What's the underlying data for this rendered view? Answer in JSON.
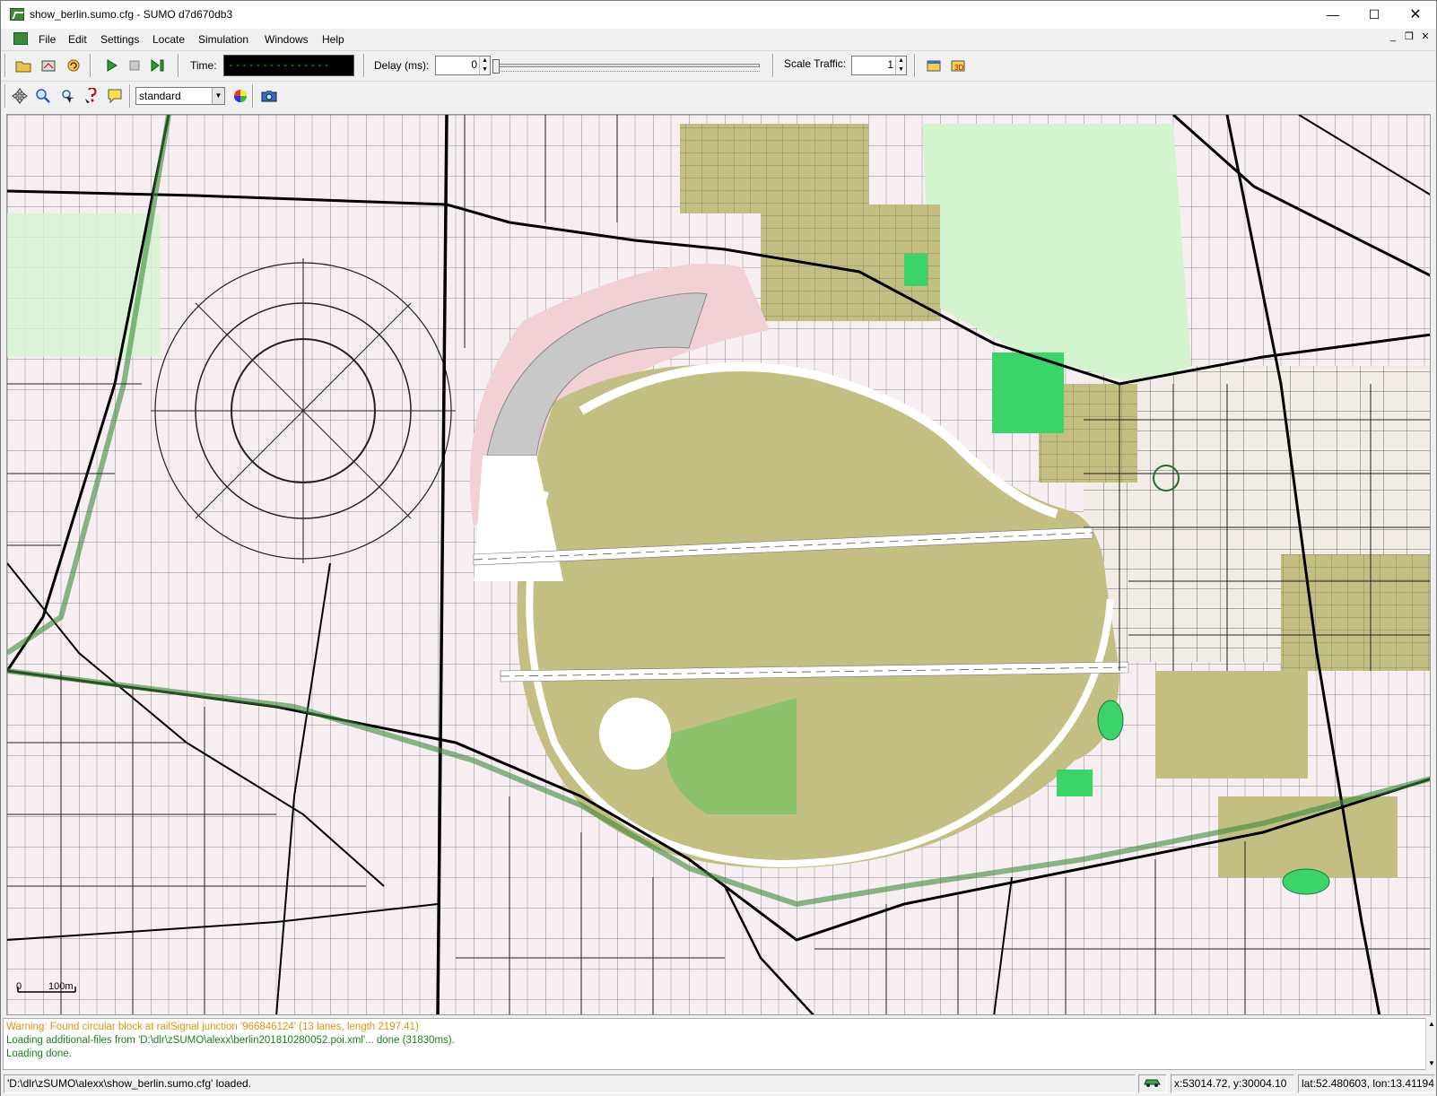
{
  "window": {
    "title": "show_berlin.sumo.cfg - SUMO d7d670db3",
    "minimize_glyph": "—",
    "maximize_glyph": "☐",
    "close_glyph": "✕",
    "mdi_minimize": "_",
    "mdi_restore": "❐",
    "mdi_close": "✕"
  },
  "menu": [
    "File",
    "Edit",
    "Settings",
    "Locate",
    "Simulation",
    "Windows",
    "Help"
  ],
  "toolbar1": {
    "time_label": "Time:",
    "time_value": "---------------",
    "delay_label": "Delay (ms):",
    "delay_value": "0",
    "delay_slider_fraction": 0,
    "scale_label": "Scale Traffic:",
    "scale_value": "1",
    "icons": [
      "open-config-icon",
      "open-network-icon",
      "reload-icon",
      "run-icon",
      "stop-icon",
      "step-icon",
      "open-new-view-icon",
      "open-3d-view-icon"
    ]
  },
  "toolbar2": {
    "scheme": "standard",
    "icons": [
      "recenter-icon",
      "zoom-icon",
      "locate-icon",
      "show-tooltip-icon",
      "show-info-icon",
      "color-scheme-icon",
      "screenshot-icon"
    ]
  },
  "map": {
    "scale_zero": "0",
    "scale_label": "100m"
  },
  "messages": [
    {
      "kind": "warn",
      "text": "Warning: Found circular block at railSignal junction '966846124' (13 lanes, length 2197.41)"
    },
    {
      "kind": "ok",
      "text": "Loading additional-files from 'D:\\dlr\\zSUMO\\alexx\\berlin201810280052.poi.xml'... done (31830ms)."
    },
    {
      "kind": "ok",
      "text": "Loading done."
    }
  ],
  "status": {
    "message": "'D:\\dlr\\zSUMO\\alexx\\show_berlin.sumo.cfg' loaded.",
    "coords": "x:53014.72, y:30004.10",
    "geo": "lat:52.480603, lon:13.411940"
  },
  "colors": {
    "terrain": "#c3bf83",
    "park": "#d4f4d0",
    "residential": "#f6eef0",
    "pink": "#e8b8c0",
    "road": "#000000",
    "runway": "#ffffff",
    "sports": "#3dd36b"
  }
}
